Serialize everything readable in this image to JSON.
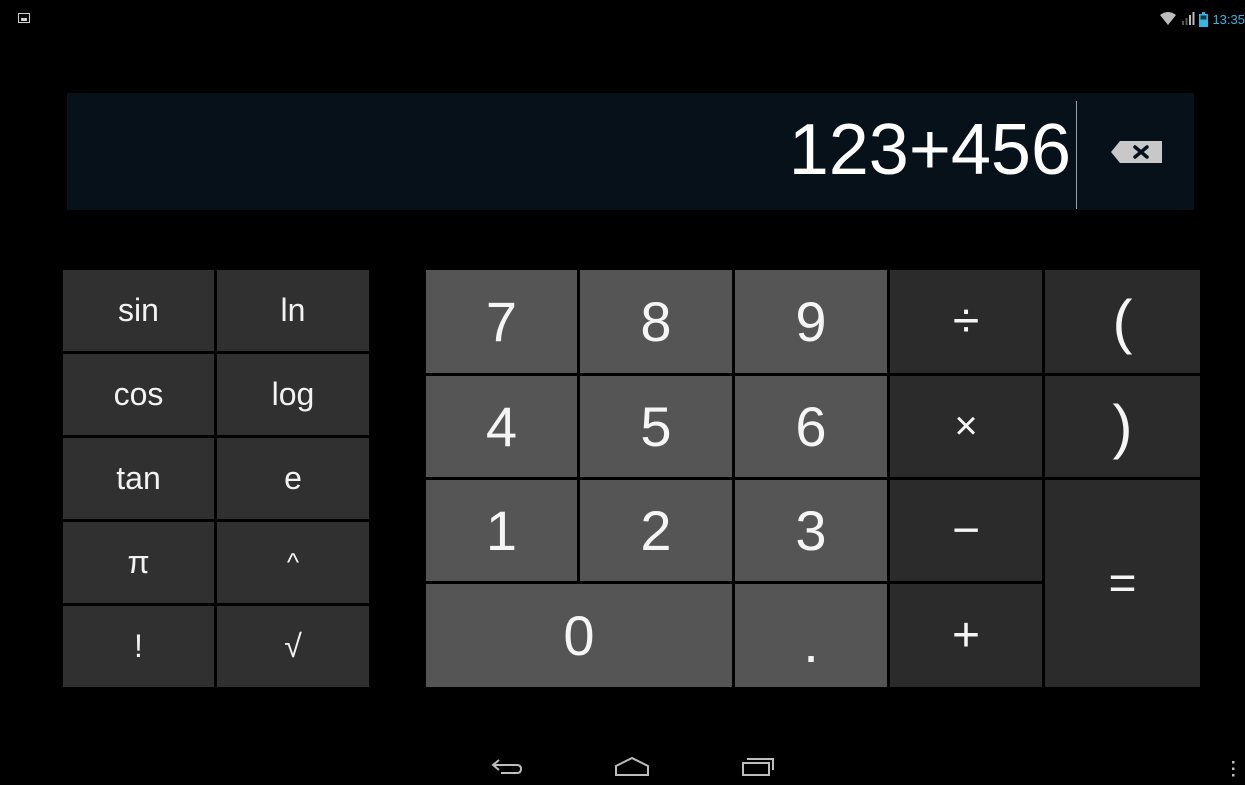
{
  "status_bar": {
    "time": "13:35",
    "icons": [
      "notification-image-icon",
      "wifi-icon",
      "signal-icon",
      "battery-icon"
    ]
  },
  "display": {
    "expression": "123+456",
    "backspace_icon": "backspace-icon"
  },
  "advanced_keys": [
    {
      "label": "sin",
      "name": "sin"
    },
    {
      "label": "ln",
      "name": "ln"
    },
    {
      "label": "cos",
      "name": "cos"
    },
    {
      "label": "log",
      "name": "log"
    },
    {
      "label": "tan",
      "name": "tan"
    },
    {
      "label": "e",
      "name": "e"
    },
    {
      "label": "π",
      "name": "pi"
    },
    {
      "label": "^",
      "name": "power"
    },
    {
      "label": "!",
      "name": "factorial"
    },
    {
      "label": "√",
      "name": "sqrt"
    }
  ],
  "digits": {
    "d7": "7",
    "d8": "8",
    "d9": "9",
    "d4": "4",
    "d5": "5",
    "d6": "6",
    "d1": "1",
    "d2": "2",
    "d3": "3",
    "d0": "0",
    "dot": "."
  },
  "operators": {
    "divide": "÷",
    "multiply": "×",
    "minus": "−",
    "plus": "+",
    "equals": "="
  },
  "parens": {
    "open": "(",
    "close": ")"
  },
  "nav_bar": {
    "icons": [
      "back-icon",
      "home-icon",
      "recents-icon",
      "overflow-menu-icon"
    ]
  },
  "colors": {
    "accent": "#33b5e5",
    "display_bg": "#06111a",
    "digit_key": "#555555",
    "operator_key": "#2b2b2b",
    "advanced_key": "#303030"
  }
}
